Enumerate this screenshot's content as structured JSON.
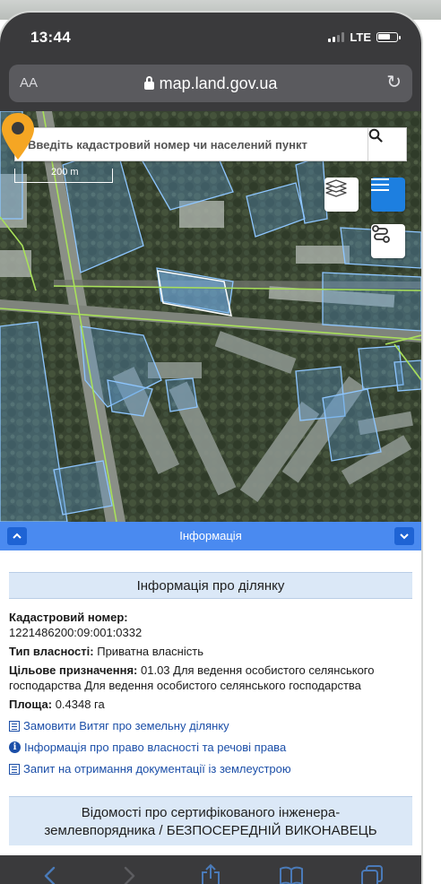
{
  "status_bar": {
    "time": "13:44",
    "network": "LTE"
  },
  "browser": {
    "text_size": "AA",
    "url": "map.land.gov.ua"
  },
  "map": {
    "search_placeholder": "Введіть кадастровий номер чи населений пункт",
    "scale_label": "200 m"
  },
  "info_panel": {
    "header": "Інформація",
    "section_title": "Інформація про ділянку",
    "cadastral_label": "Кадастровий номер:",
    "cadastral_number": "1221486200:09:001:0332",
    "ownership_label": "Тип власності:",
    "ownership_value": "Приватна власність",
    "purpose_label": "Цільове призначення:",
    "purpose_value": "01.03 Для ведення особистого селянського господарства Для ведення особистого селянського господарства",
    "area_label": "Площа:",
    "area_value": "0.4348 га",
    "links": [
      "Замовити Витяг про земельну ділянку",
      "Інформація про право власності та речові права",
      "Запит на отримання документації із землеустрою"
    ],
    "engineer_section_line1": "Відомості про сертифікованого інженера-",
    "engineer_section_line2": "землевпорядника / БЕЗПОСЕРЕДНІЙ ВИКОНАВЕЦЬ"
  },
  "colors": {
    "browser_chrome": "#3a3a3c",
    "info_header": "#4a8af0",
    "menu_button": "#1d7fe0",
    "pin": "#f5a623",
    "parcel_outline": "#8ec6ff",
    "road_line": "#a8e05a",
    "link": "#1c4fa8"
  },
  "icons": {
    "search": "search-icon",
    "layers": "layers-icon",
    "menu": "menu-icon",
    "route": "route-icon",
    "pin": "location-pin-icon",
    "toolbar": [
      "back-icon",
      "forward-icon",
      "share-icon",
      "bookmarks-icon",
      "tabs-icon"
    ]
  }
}
